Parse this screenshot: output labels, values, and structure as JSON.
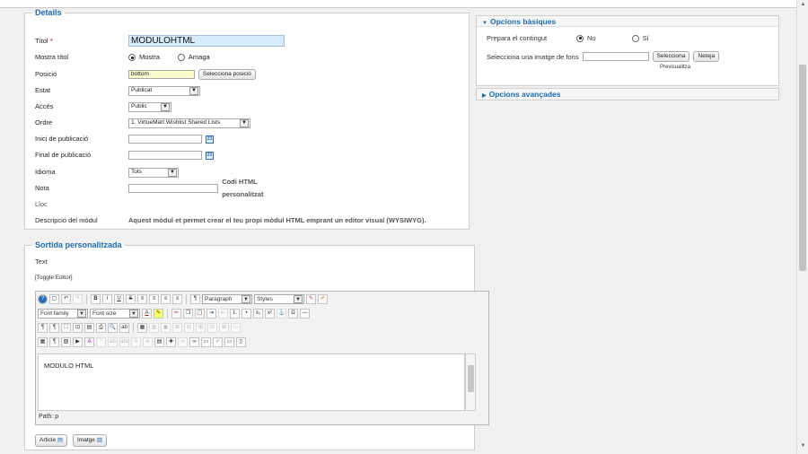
{
  "details": {
    "legend": "Details",
    "fields": {
      "title_label": "Títol",
      "title_required": "*",
      "title_value": "MODULOHTML",
      "show_title_label": "Mostra títol",
      "show_option": "Mostra",
      "hide_option": "Amaga",
      "position_label": "Posició",
      "position_value": "bottom",
      "position_button": "Selecciona posició",
      "status_label": "Estat",
      "status_value": "Publicat",
      "access_label": "Accés",
      "access_value": "Public",
      "order_label": "Ordre",
      "order_value": "1. VirtueMart Wishlist Shared Lists",
      "publish_start_label": "Inici de publicació",
      "publish_end_label": "Final de publicació",
      "calendar_icon_text": "23",
      "language_label": "Idioma",
      "language_value": "Tots",
      "note_label": "Nota",
      "note_helper": "Codi HTML personalitzat",
      "site_label": "Lloc",
      "description_label": "Descripció del mòdul",
      "description_value": "Aquest mòdul et permet crear el teu propi mòdul HTML emprant un editor visual (WYSIWYG)."
    }
  },
  "basic_options": {
    "header": "Opcions bàsiques",
    "prepare_label": "Prepara el contingut",
    "no_option": "No",
    "yes_option": "Sí",
    "bg_image_label": "Selecciona una imatge de fons",
    "select_button": "Selecciona",
    "clear_button": "Neteja",
    "preview_label": "Previsualitza"
  },
  "advanced_options": {
    "header": "Opcions avançades"
  },
  "custom_output": {
    "legend": "Sortida personalitzada",
    "text_label": "Text",
    "toggle_editor": "[Toggle Editor]",
    "paragraph_select": "Paragraph",
    "styles_select": "Styles",
    "font_family_select": "Font family",
    "font_size_select": "Font size",
    "editor_content": "MODULO HTML",
    "path_text": "Path: p",
    "article_button": "Article",
    "image_button": "Imatge"
  },
  "colors": {
    "accent": "#1a6bb3",
    "title_input_bg": "#d7ebfb",
    "position_input_bg": "#fbfbcc"
  }
}
